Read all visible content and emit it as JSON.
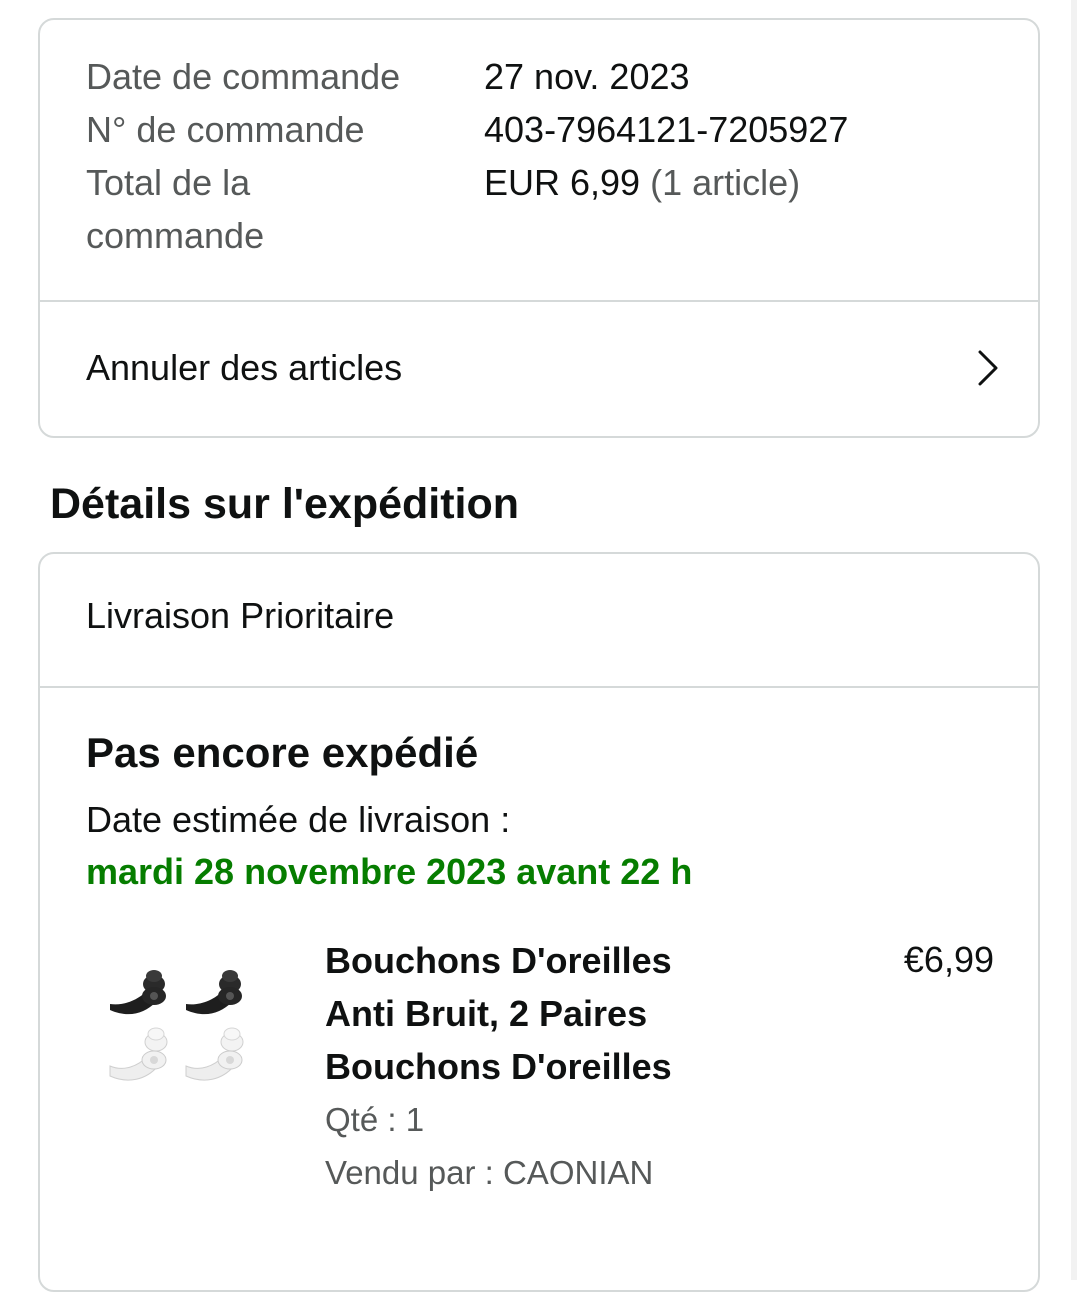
{
  "order_summary": {
    "date_label": "Date de commande",
    "date_value": "27 nov. 2023",
    "number_label": "N° de commande",
    "number_value": "403-7964121-7205927",
    "total_label_line1": "Total de la",
    "total_label_line2": "commande",
    "total_value": "EUR 6,99",
    "total_count": "(1 article)"
  },
  "actions": {
    "cancel_label": "Annuler des articles"
  },
  "shipping": {
    "section_title": "Détails sur l'expédition",
    "method": "Livraison Prioritaire",
    "status": "Pas encore expédié",
    "estimated_label": "Date estimée de livraison :",
    "estimated_date": "mardi 28 novembre 2023 avant 22 h"
  },
  "item": {
    "title_line1": "Bouchons D'oreilles",
    "title_line2": "Anti Bruit, 2 Paires",
    "title_line3": "Bouchons D'oreilles",
    "quantity": "Qté : 1",
    "seller": "Vendu par : CAONIAN",
    "price": "€6,99",
    "image_icon": "earplugs-product-image"
  },
  "colors": {
    "delivery_green": "#067d00",
    "secondary_text": "#565959",
    "border": "#d5d9d9"
  }
}
